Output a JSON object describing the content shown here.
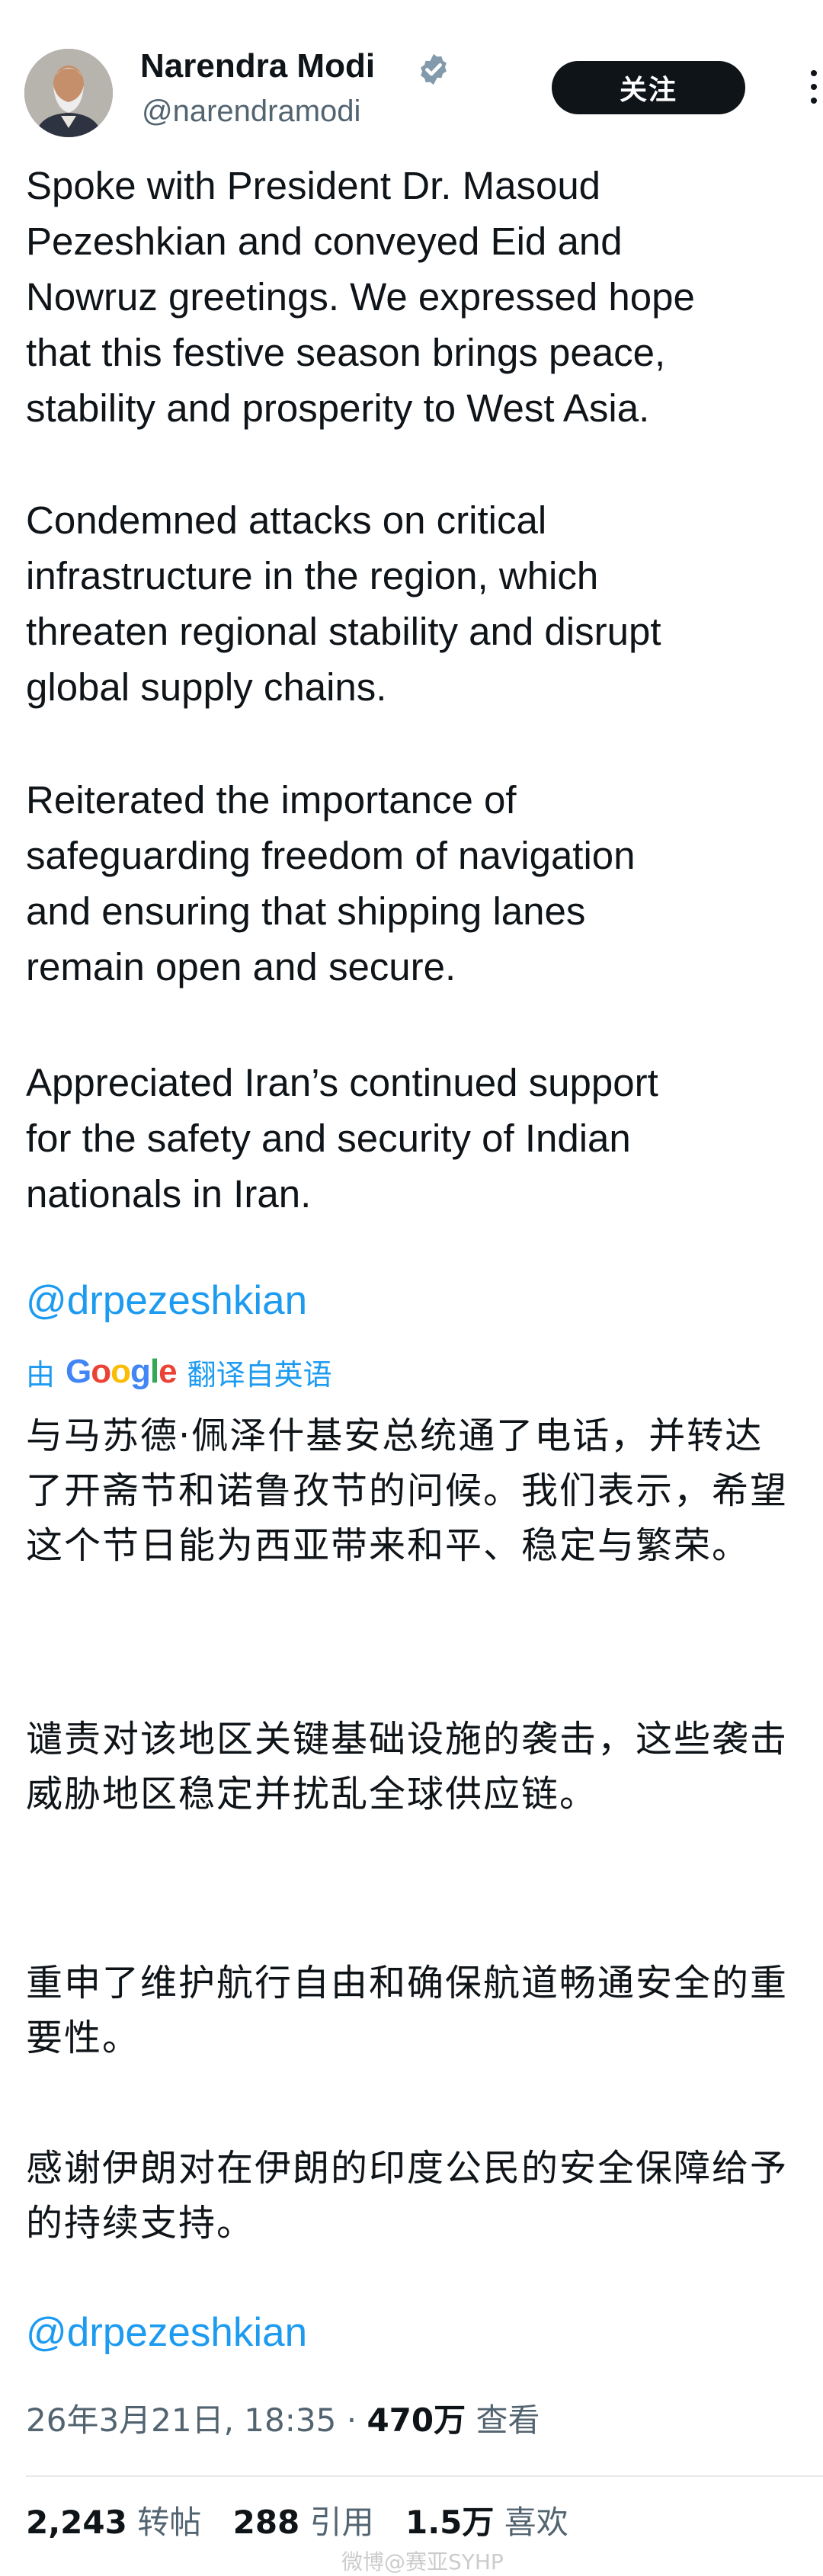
{
  "author": {
    "name": "Narendra Modi",
    "handle": "@narendramodi",
    "verified_icon": "verified-badge-icon",
    "avatar_icon": "avatar-photo"
  },
  "header": {
    "follow_label": "关注",
    "more_icon": "more-options-icon"
  },
  "post": {
    "paragraphs": [
      "Spoke with President Dr. Masoud\nPezeshkian and conveyed Eid and\nNowruz greetings. We expressed hope\nthat this festive season brings peace,\nstability and prosperity to West Asia.",
      "Condemned attacks on critical\ninfrastructure in the region, which\nthreaten regional stability and disrupt\nglobal supply chains.",
      "Reiterated the importance of\nsafeguarding freedom of navigation\nand ensuring that shipping lanes\nremain open and secure.",
      "Appreciated Iran’s continued support\nfor the safety and security of Indian\nnationals in Iran."
    ],
    "mention": "@drpezeshkian"
  },
  "translation": {
    "prefix": "由",
    "provider": "Google",
    "suffix": "翻译自英语",
    "paragraphs": [
      "与马苏德·佩泽什基安总统通了电话，并转达了开斋节和诺鲁孜节的问候。我们表示，希望这个节日能为西亚带来和平、稳定与繁荣。",
      "谴责对该地区关键基础设施的袭击，这些袭击威胁地区稳定并扰乱全球供应链。",
      "重申了维护航行自由和确保航道畅通安全的重要性。",
      "感谢伊朗对在伊朗的印度公民的安全保障给予的持续支持。"
    ],
    "mention": "@drpezeshkian"
  },
  "meta": {
    "date": "26年3月21日, 18:35",
    "separator": "·",
    "views": "470万",
    "views_label": "查看"
  },
  "stats": {
    "reposts": "2,243",
    "reposts_label": "转帖",
    "quotes": "288",
    "quotes_label": "引用",
    "likes": "1.5万",
    "likes_label": "喜欢"
  },
  "watermark": "微博@赛亚SYHP",
  "colors": {
    "text": "#0f1419",
    "secondary": "#536471",
    "link": "#1d9bf0",
    "button": "#0f1419"
  }
}
